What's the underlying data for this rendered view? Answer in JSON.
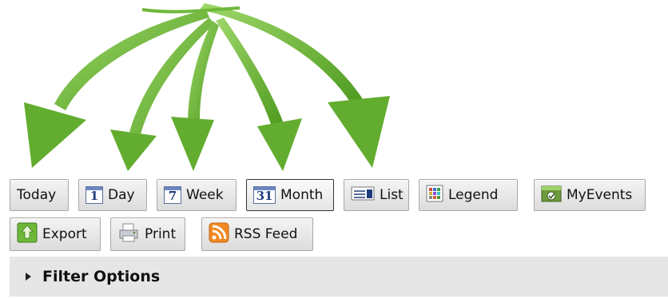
{
  "toolbar": {
    "row1": [
      {
        "id": "today",
        "label": "Today",
        "icon": "none"
      },
      {
        "id": "day",
        "label": "Day",
        "icon": "calendar-1-icon",
        "glyph": "1"
      },
      {
        "id": "week",
        "label": "Week",
        "icon": "calendar-7-icon",
        "glyph": "7"
      },
      {
        "id": "month",
        "label": "Month",
        "icon": "calendar-31-icon",
        "glyph": "31",
        "active": true
      },
      {
        "id": "list",
        "label": "List",
        "icon": "list-icon"
      },
      {
        "id": "legend",
        "label": "Legend",
        "icon": "legend-icon"
      },
      {
        "id": "myevents",
        "label": "MyEvents",
        "icon": "myevents-icon"
      }
    ],
    "row2": [
      {
        "id": "export",
        "label": "Export",
        "icon": "export-icon"
      },
      {
        "id": "print",
        "label": "Print",
        "icon": "printer-icon"
      },
      {
        "id": "rss",
        "label": "RSS Feed",
        "icon": "rss-icon"
      }
    ]
  },
  "filter": {
    "label": "Filter Options",
    "icon": "expand-triangle-icon"
  },
  "decoration": {
    "arrows_icon": "green-arrows-illustration",
    "arrow_color": "#6fb83a"
  }
}
